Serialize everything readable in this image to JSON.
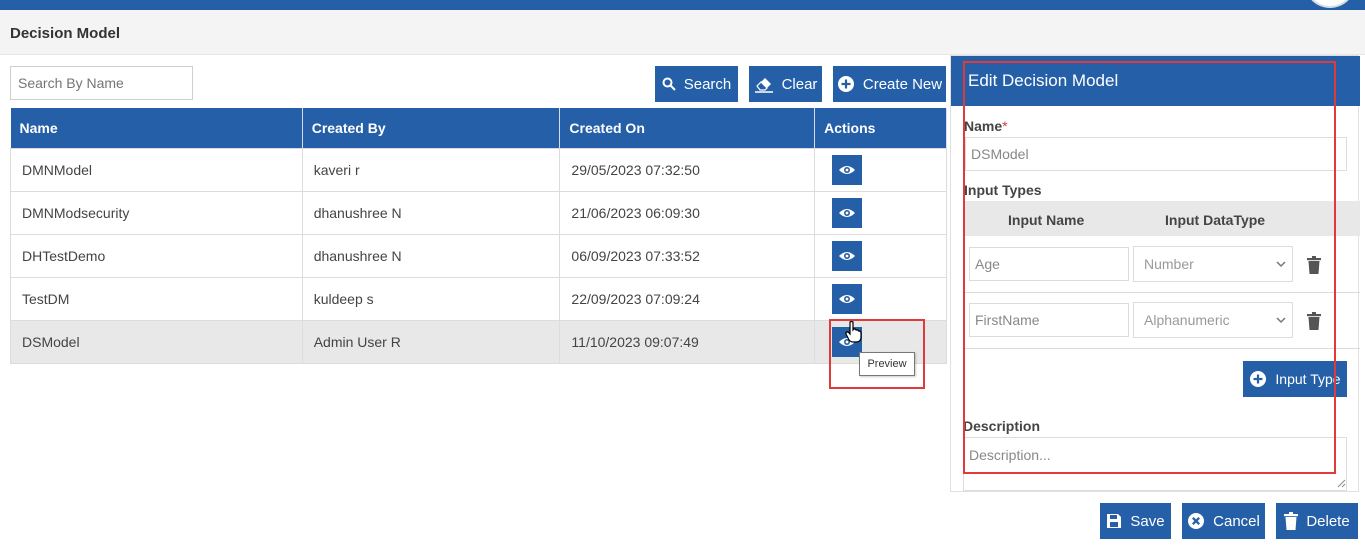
{
  "header": {
    "title": "Decision Model"
  },
  "toolbar": {
    "search_placeholder": "Search By Name",
    "search_label": "Search",
    "clear_label": "Clear",
    "create_label": "Create New"
  },
  "table": {
    "columns": [
      "Name",
      "Created By",
      "Created On",
      "Actions"
    ],
    "rows": [
      {
        "name": "DMNModel",
        "created_by": "kaveri r",
        "created_on": "29/05/2023 07:32:50"
      },
      {
        "name": "DMNModsecurity",
        "created_by": "dhanushree N",
        "created_on": "21/06/2023 06:09:30"
      },
      {
        "name": "DHTestDemo",
        "created_by": "dhanushree N",
        "created_on": "06/09/2023 07:33:52"
      },
      {
        "name": "TestDM",
        "created_by": "kuldeep s",
        "created_on": "22/09/2023 07:09:24"
      },
      {
        "name": "DSModel",
        "created_by": "Admin User R",
        "created_on": "11/10/2023 09:07:49"
      }
    ],
    "selected_row": 4,
    "tooltip": "Preview"
  },
  "panel": {
    "title": "Edit Decision Model",
    "name_label": "Name",
    "required_mark": "*",
    "name_value": "DSModel",
    "input_types_label": "Input Types",
    "input_name_header": "Input Name",
    "input_datatype_header": "Input DataType",
    "inputs": [
      {
        "name": "Age",
        "datatype": "Number"
      },
      {
        "name": "FirstName",
        "datatype": "Alphanumeric"
      }
    ],
    "add_input_label": "Input Type",
    "description_label": "Description",
    "description_placeholder": "Description..."
  },
  "footer": {
    "save_label": "Save",
    "cancel_label": "Cancel",
    "delete_label": "Delete"
  },
  "colors": {
    "primary": "#245fa8",
    "highlight": "#e03a3a"
  }
}
